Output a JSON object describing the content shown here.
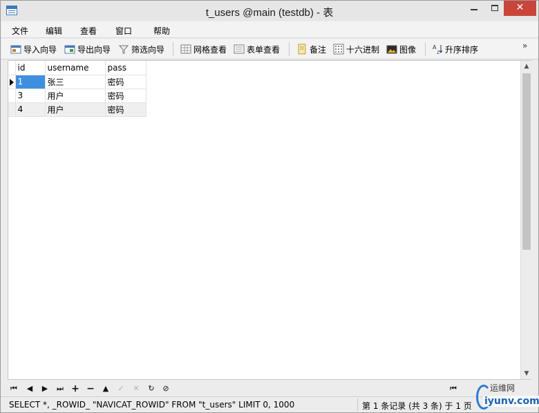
{
  "window": {
    "title": "t_users @main (testdb) - 表",
    "close_glyph": "✕"
  },
  "menu": [
    "文件",
    "编辑",
    "查看",
    "窗口",
    "帮助"
  ],
  "toolbar": {
    "import_wizard": "导入向导",
    "export_wizard": "导出向导",
    "filter_wizard": "筛选向导",
    "grid_view": "网格查看",
    "form_view": "表单查看",
    "memo": "备注",
    "hex": "十六进制",
    "image": "图像",
    "sort_asc": "升序排序",
    "more": "»"
  },
  "grid": {
    "columns": [
      "id",
      "username",
      "pass"
    ],
    "rows": [
      [
        "1",
        "张三",
        "密码"
      ],
      [
        "3",
        "用户",
        "密码"
      ],
      [
        "4",
        "用户",
        "密码"
      ]
    ]
  },
  "statusbar": {
    "sql": "SELECT *, _ROWID_ \"NAVICAT_ROWID\" FROM \"t_users\" LIMIT 0, 1000",
    "record_info": "第 1 条记录 (共 3 条) 于 1 页"
  },
  "watermark": {
    "line1": "运维网",
    "line2": "iyunv.com"
  },
  "colors": {
    "selection": "#3f8fe0",
    "close_button": "#c9453a"
  }
}
